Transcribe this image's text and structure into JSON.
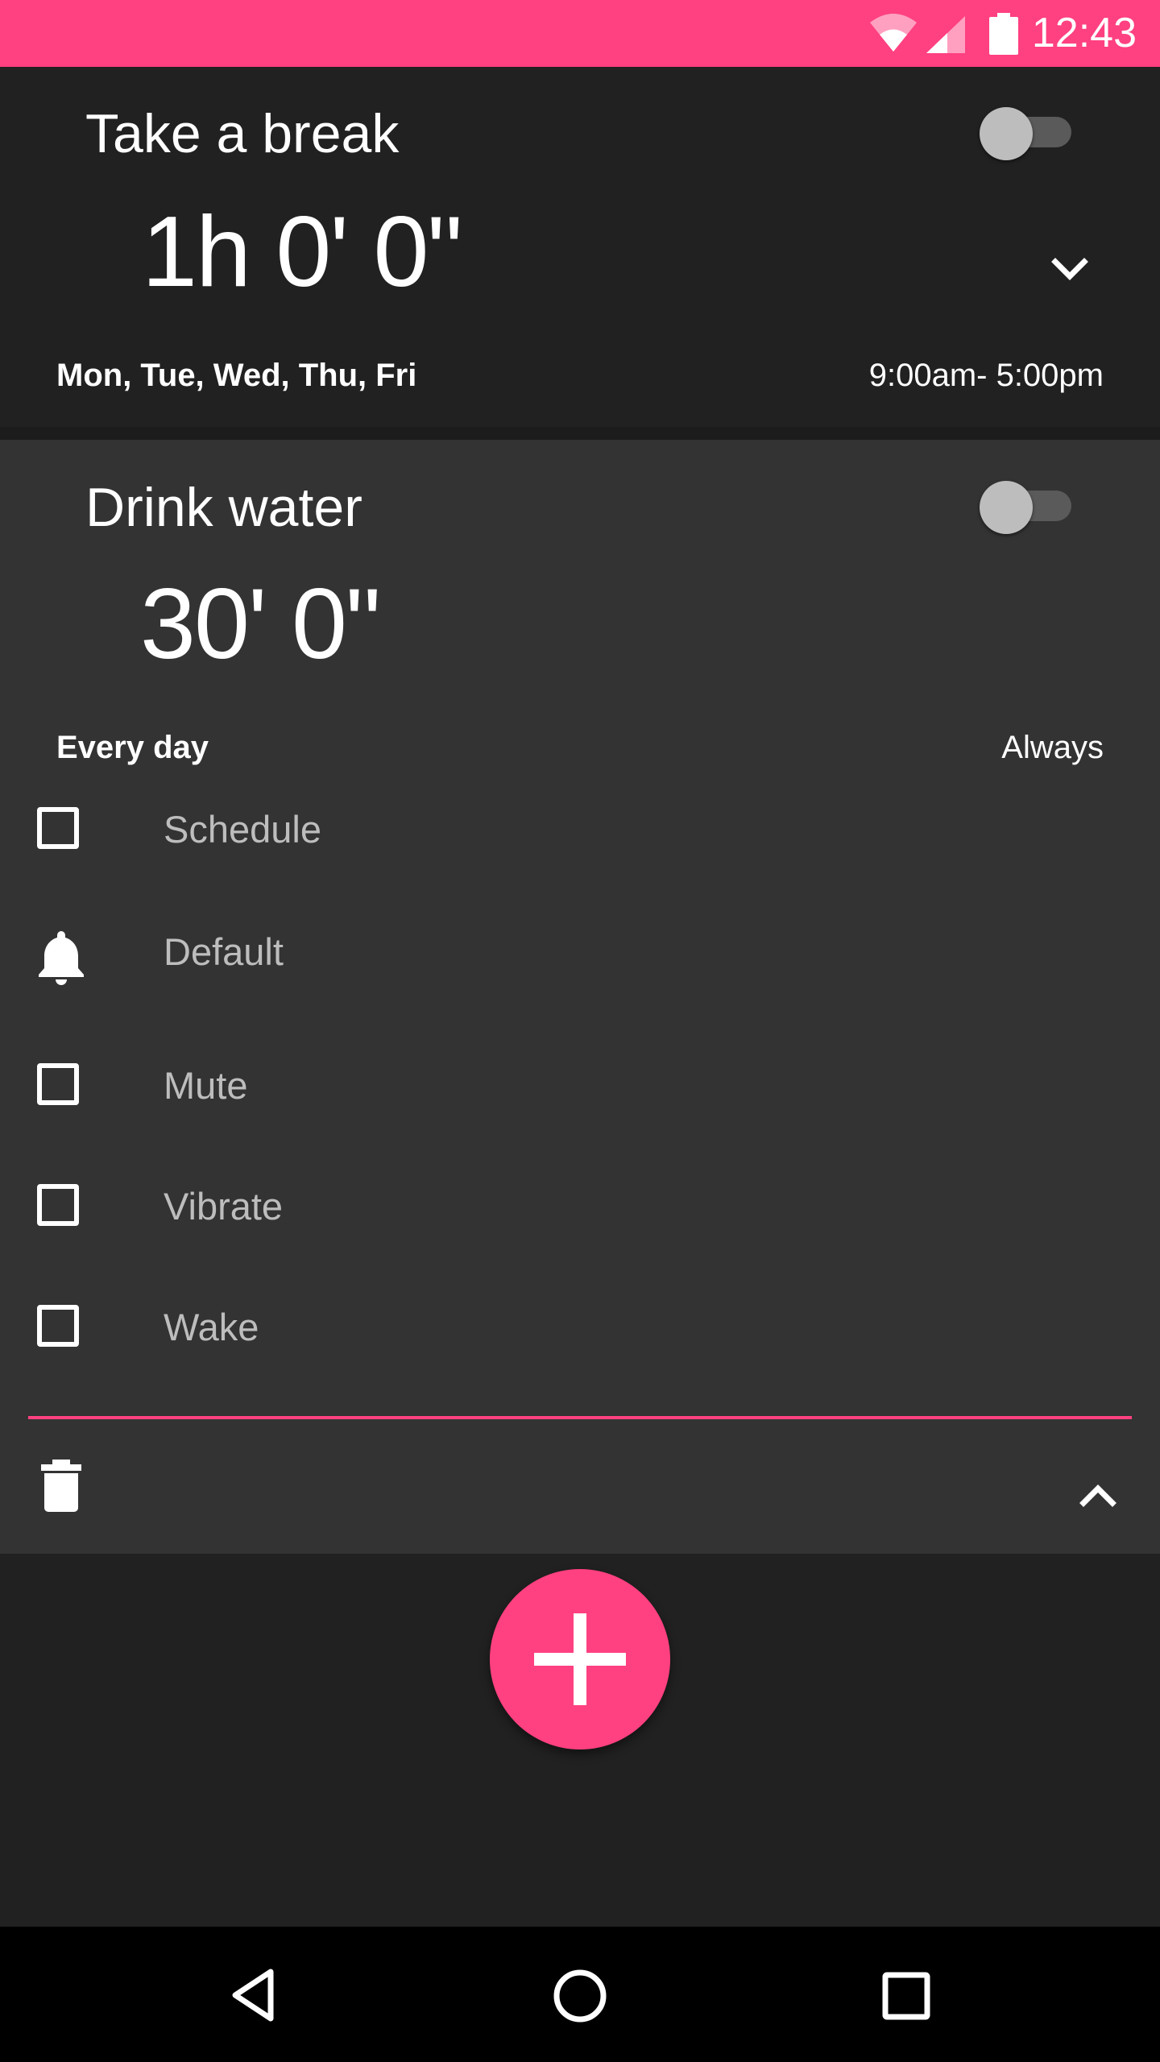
{
  "status_bar": {
    "time": "12:43",
    "background_color": "#ff4081"
  },
  "alarms": [
    {
      "title": "Take a break",
      "duration": "1h 0' 0\"",
      "days": "Mon, Tue, Wed, Thu, Fri",
      "hours": "9:00am- 5:00pm",
      "enabled": false,
      "expanded": false,
      "expand_icon": "chevron-down-icon"
    },
    {
      "title": "Drink water",
      "duration": "30' 0\"",
      "days": "Every day",
      "hours": "Always",
      "enabled": false,
      "expanded": true,
      "options": [
        {
          "label": "Schedule",
          "icon": "checkbox-unchecked",
          "checked": false
        },
        {
          "label": "Default",
          "icon": "bell-icon"
        },
        {
          "label": "Mute",
          "icon": "checkbox-unchecked",
          "checked": false
        },
        {
          "label": "Vibrate",
          "icon": "checkbox-unchecked",
          "checked": false
        },
        {
          "label": "Wake",
          "icon": "checkbox-unchecked",
          "checked": false
        }
      ],
      "delete_icon": "trash-icon",
      "collapse_icon": "chevron-up-icon"
    }
  ],
  "fab": {
    "icon": "plus-icon",
    "color": "#ff4081"
  },
  "nav_bar": {
    "buttons": [
      "back-icon",
      "home-icon",
      "recents-icon"
    ]
  },
  "colors": {
    "accent": "#ff4081",
    "background": "#212121",
    "expanded_card": "#333333"
  }
}
